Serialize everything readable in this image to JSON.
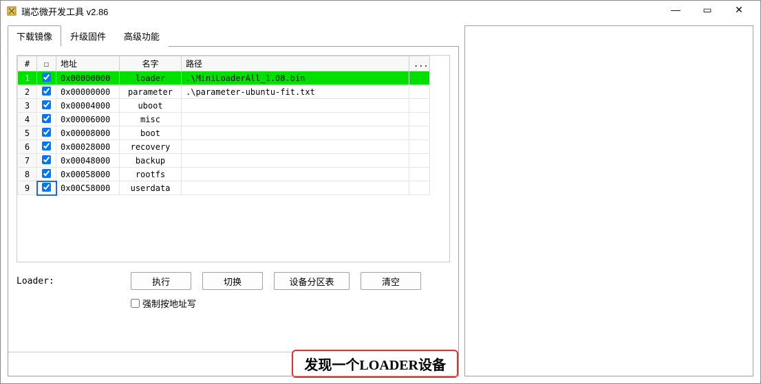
{
  "window": {
    "title": "瑞芯微开发工具 v2.86",
    "minimize_glyph": "—",
    "maximize_glyph": "▭",
    "close_glyph": "✕"
  },
  "tabs": {
    "download": "下载镜像",
    "upgrade": "升级固件",
    "advanced": "高级功能"
  },
  "table": {
    "headers": {
      "idx": "#",
      "chk": "☐",
      "addr": "地址",
      "name": "名字",
      "path": "路径",
      "more": "..."
    },
    "rows": [
      {
        "idx": "1",
        "checked": true,
        "addr": "0x00000000",
        "name": "loader",
        "path": ".\\MiniLoaderAll_1.08.bin",
        "selected": true
      },
      {
        "idx": "2",
        "checked": true,
        "addr": "0x00000000",
        "name": "parameter",
        "path": ".\\parameter-ubuntu-fit.txt",
        "selected": false
      },
      {
        "idx": "3",
        "checked": true,
        "addr": "0x00004000",
        "name": "uboot",
        "path": "",
        "selected": false
      },
      {
        "idx": "4",
        "checked": true,
        "addr": "0x00006000",
        "name": "misc",
        "path": "",
        "selected": false
      },
      {
        "idx": "5",
        "checked": true,
        "addr": "0x00008000",
        "name": "boot",
        "path": "",
        "selected": false
      },
      {
        "idx": "6",
        "checked": true,
        "addr": "0x00028000",
        "name": "recovery",
        "path": "",
        "selected": false
      },
      {
        "idx": "7",
        "checked": true,
        "addr": "0x00048000",
        "name": "backup",
        "path": "",
        "selected": false
      },
      {
        "idx": "8",
        "checked": true,
        "addr": "0x00058000",
        "name": "rootfs",
        "path": "",
        "selected": false
      },
      {
        "idx": "9",
        "checked": true,
        "addr": "0x00C58000",
        "name": "userdata",
        "path": "",
        "selected": false
      }
    ]
  },
  "actions": {
    "loader_label": "Loader:",
    "execute": "执行",
    "switch": "切换",
    "partition": "设备分区表",
    "clear": "清空",
    "force_write": "强制按地址写"
  },
  "status": {
    "message": "发现一个LOADER设备"
  }
}
